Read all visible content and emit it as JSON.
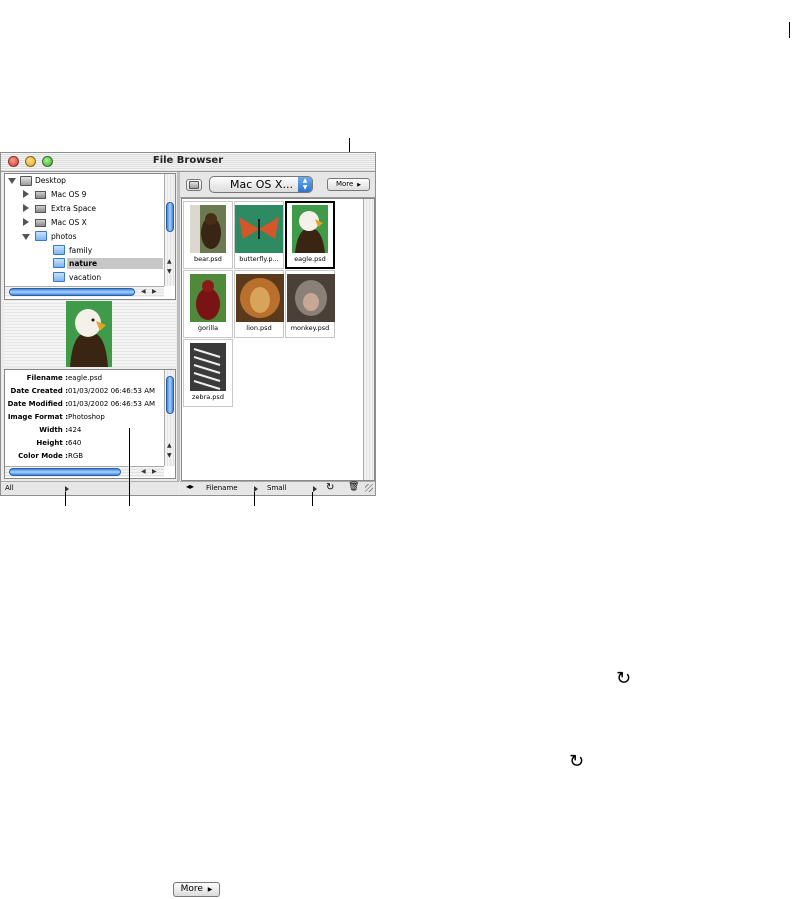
{
  "window": {
    "title": "File Browser"
  },
  "tree": {
    "items": [
      {
        "label": "Desktop"
      },
      {
        "label": "Mac OS 9"
      },
      {
        "label": "Extra Space"
      },
      {
        "label": "Mac OS X"
      },
      {
        "label": "photos"
      },
      {
        "label": "family"
      },
      {
        "label": "nature",
        "selected": true
      },
      {
        "label": "vacation"
      }
    ]
  },
  "location": {
    "selected": "Mac OS X..."
  },
  "more_button": {
    "label": "More"
  },
  "metadata": {
    "rows": [
      {
        "label": "Filename :",
        "value": "eagle.psd"
      },
      {
        "label": "Date Created :",
        "value": "01/03/2002 06:46:53 AM"
      },
      {
        "label": "Date Modified :",
        "value": "01/03/2002 06:46:53 AM"
      },
      {
        "label": "Image Format :",
        "value": "Photoshop"
      },
      {
        "label": "Width :",
        "value": "424"
      },
      {
        "label": "Height :",
        "value": "640"
      },
      {
        "label": "Color Mode :",
        "value": "RGB"
      }
    ]
  },
  "thumbnails": [
    {
      "name": "bear.psd"
    },
    {
      "name": "butterfly.p..."
    },
    {
      "name": "eagle.psd",
      "selected": true
    },
    {
      "name": "gorilla"
    },
    {
      "name": "lion.psd"
    },
    {
      "name": "monkey.psd"
    },
    {
      "name": "zebra.psd"
    }
  ],
  "status": {
    "left_menu": "All",
    "sort_by": "Filename",
    "view_size": "Small"
  },
  "colors": {
    "accent": "#3f86db",
    "selection": "#c7c7c7"
  },
  "icons": [
    "folder-icon",
    "disk-icon",
    "rotate-icon",
    "trash-icon",
    "expand-icon",
    "up-folder-icon"
  ]
}
